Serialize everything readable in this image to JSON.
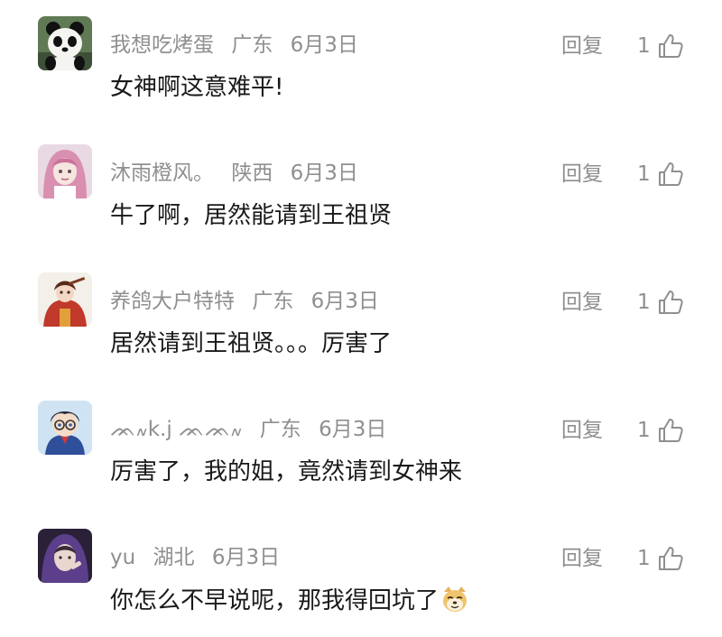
{
  "comments": [
    {
      "username": "我想吃烤蛋",
      "location": "广东",
      "date": "6月3日",
      "text": "女神啊这意难平!",
      "reply_label": "回复",
      "likes": "1",
      "avatar": "panda-avatar-icon"
    },
    {
      "username": "沐雨橙风。",
      "location": "陕西",
      "date": "6月3日",
      "text": "牛了啊，居然能请到王祖贤",
      "reply_label": "回复",
      "likes": "1",
      "avatar": "anime-girl-avatar-icon"
    },
    {
      "username": "养鸽大户特特",
      "location": "广东",
      "date": "6月3日",
      "text": "居然请到王祖贤。。。厉害了",
      "reply_label": "回复",
      "likes": "1",
      "avatar": "red-costume-avatar-icon"
    },
    {
      "username": "ᨏ៷k.j ᨏᨏ៷",
      "location": "广东",
      "date": "6月3日",
      "text": "厉害了，我的姐，竟然请到女神来",
      "reply_label": "回复",
      "likes": "1",
      "avatar": "conan-avatar-icon"
    },
    {
      "username": "yu",
      "location": "湖北",
      "date": "6月3日",
      "text": "你怎么不早说呢，那我得回坑了",
      "reply_label": "回复",
      "likes": "1",
      "avatar": "purple-hood-avatar-icon",
      "trailing_emoji": "doge-emoji-icon"
    }
  ],
  "colors": {
    "meta_text": "#8f8f8f",
    "body_text": "#1a1a1a",
    "background": "#ffffff"
  }
}
